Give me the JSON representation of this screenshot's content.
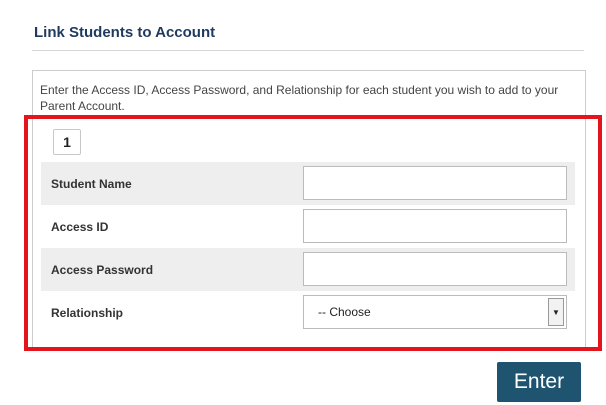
{
  "header": {
    "title": "Link Students to Account"
  },
  "instructions": "Enter the Access ID, Access Password, and Relationship for each student you wish to add to your Parent Account.",
  "student_index": "1",
  "fields": {
    "student_name": {
      "label": "Student Name",
      "value": ""
    },
    "access_id": {
      "label": "Access ID",
      "value": ""
    },
    "access_password": {
      "label": "Access Password",
      "value": ""
    },
    "relationship": {
      "label": "Relationship",
      "selected": "-- Choose"
    }
  },
  "actions": {
    "enter_label": "Enter"
  },
  "colors": {
    "title": "#1f3a5f",
    "highlight": "#e3141b",
    "button": "#1e5470",
    "row_shade": "#eeeeee"
  }
}
